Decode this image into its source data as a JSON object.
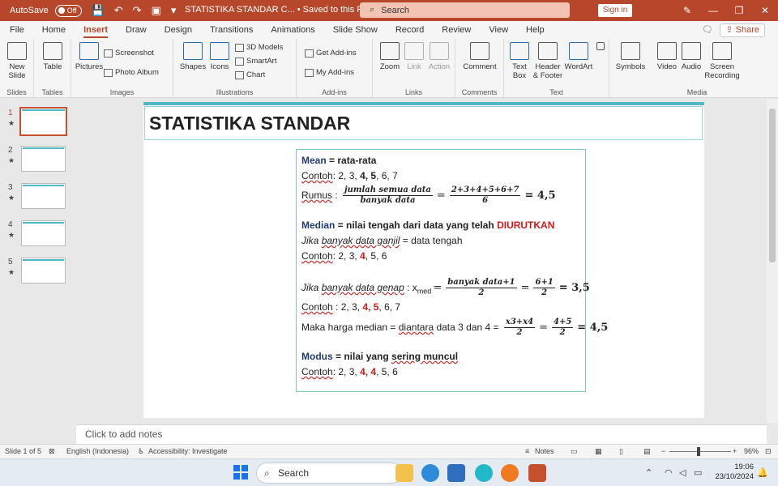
{
  "titlebar": {
    "autosave_label": "AutoSave",
    "autosave_state": "Off",
    "doc_title": "STATISTIKA STANDAR C...  •  Saved to this PC",
    "search_placeholder": "Search",
    "signin": "Sign in"
  },
  "menu": {
    "tabs": [
      "File",
      "Home",
      "Insert",
      "Draw",
      "Design",
      "Transitions",
      "Animations",
      "Slide Show",
      "Record",
      "Review",
      "View",
      "Help"
    ],
    "active": "Insert",
    "share": "Share"
  },
  "ribbon": {
    "groups": {
      "slides": "Slides",
      "tables": "Tables",
      "images": "Images",
      "illustrations": "Illustrations",
      "addins": "Add-ins",
      "links": "Links",
      "comments": "Comments",
      "text": "Text",
      "media": "Media"
    },
    "new_slide": "New Slide",
    "table": "Table",
    "pictures": "Pictures",
    "screenshot": "Screenshot",
    "photo_album": "Photo Album",
    "shapes": "Shapes",
    "icons": "Icons",
    "models3d": "3D Models",
    "smartart": "SmartArt",
    "chart": "Chart",
    "get_addins": "Get Add-ins",
    "my_addins": "My Add-ins",
    "zoom": "Zoom",
    "link": "Link",
    "action": "Action",
    "comment": "Comment",
    "text_box": "Text Box",
    "header_footer": "Header & Footer",
    "wordart": "WordArt",
    "symbols": "Symbols",
    "video": "Video",
    "audio": "Audio",
    "screen_recording": "Screen Recording"
  },
  "thumbnails": [
    "1",
    "2",
    "3",
    "4",
    "5"
  ],
  "slide": {
    "title": "STATISTIKA STANDAR",
    "mean_label": "Mean",
    "mean_def": " = rata-rata",
    "contoh": "Contoh",
    "mean_example_a": ": 2, 3, ",
    "mean_example_b": "4, 5",
    "mean_example_c": ", 6, 7",
    "rumus": "Rumus",
    "rumus_colon": " : ",
    "mean_frac_num": "jumlah semua data",
    "mean_frac_den": "banyak data",
    "mean_frac2_num": "2+3+4+5+6+7",
    "mean_frac2_den": "6",
    "mean_result": "= 4,5",
    "median_label": "Median",
    "median_def_a": " = nilai tengah dari data yang telah ",
    "median_def_b": "DIURUTKAN",
    "odd_a": "Jika ",
    "odd_b": "banyak data ganjil",
    "odd_c": " = data tengah",
    "odd_example_a": ": 2, 3, ",
    "odd_example_b": "4",
    "odd_example_c": ", 5, 6",
    "even_a": "Jika ",
    "even_b": "banyak data genap",
    "even_c": " : x",
    "even_sub": "med",
    "even_frac_num": "banyak data+1",
    "even_frac_den": "2",
    "even_frac2_num": "6+1",
    "even_frac2_den": "2",
    "even_result": "= 3,5",
    "even_example_a": " : 2, 3, ",
    "even_example_b": "4, 5",
    "even_example_c": ", 6, 7",
    "maka_a": "Maka harga median = ",
    "maka_b": "diantara",
    "maka_c": " data 3 dan 4 = ",
    "maka_frac_num": "x3+x4",
    "maka_frac_den": "2",
    "maka_frac2_num": "4+5",
    "maka_frac2_den": "2",
    "maka_result": "= 4,5",
    "modus_label": "Modus",
    "modus_def_a": " = nilai yang ",
    "modus_def_b": "sering muncul",
    "modus_example_a": ": 2, 3, ",
    "modus_example_b": "4, 4",
    "modus_example_c": ", 5, 6"
  },
  "notes_placeholder": "Click to add notes",
  "status": {
    "slide_of": "Slide 1 of 5",
    "language": "English (Indonesia)",
    "accessibility": "Accessibility: Investigate",
    "notes": "Notes",
    "zoom": "96%"
  },
  "taskbar": {
    "search": "Search",
    "time": "19:06",
    "date": "23/10/2024"
  }
}
